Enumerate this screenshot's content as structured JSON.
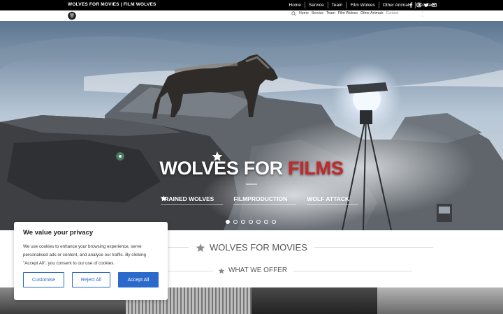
{
  "topbar": {
    "brand": "WOLVES FOR MOVIES | FILM WOLVES",
    "nav": [
      "Home",
      "Service",
      "Team",
      "Film Wolves",
      "Other Animals",
      "Contact"
    ],
    "social_icons": [
      "facebook-icon",
      "instagram-icon",
      "twitter-icon",
      "email-icon"
    ]
  },
  "subnav": {
    "items": [
      "Home",
      "Service",
      "Team",
      "Film Wolves",
      "Other Animals",
      "Contact"
    ],
    "mini": "‹  ›"
  },
  "hero": {
    "title_white": "WOLVES FOR ",
    "title_red": "FILMS",
    "links": [
      "TRAINED WOLVES",
      "FILMPRODUCTION",
      "WOLF ATTACK"
    ],
    "slides": 7,
    "active_slide": 1
  },
  "sections": {
    "movies_heading": "WOLVES FOR MOVIES",
    "offer_heading": "WHAT WE OFFER"
  },
  "cookie": {
    "title": "We value your privacy",
    "text": "We use cookies to enhance your browsing experience, serve personalised ads or content, and analyse our traffic. By clicking \"Accept All\", you consent to our use of cookies.",
    "customise": "Customise",
    "reject": "Reject All",
    "accept": "Accept All"
  },
  "colors": {
    "accent_red": "#c62828",
    "cookie_blue": "#2b6acb",
    "topbar_bg": "#000000"
  }
}
